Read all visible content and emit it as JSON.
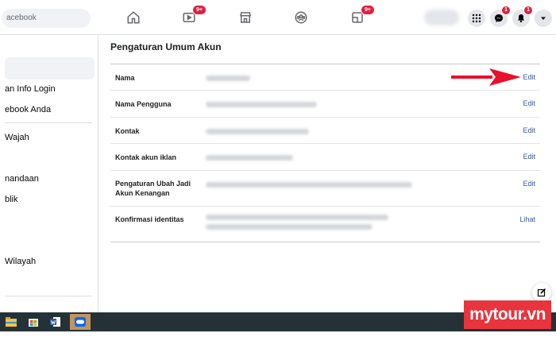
{
  "topbar": {
    "search_placeholder": "acebook",
    "nav": [
      {
        "icon": "home-icon",
        "badge": ""
      },
      {
        "icon": "watch-icon",
        "badge": "9+"
      },
      {
        "icon": "marketplace-icon",
        "badge": ""
      },
      {
        "icon": "groups-icon",
        "badge": ""
      },
      {
        "icon": "gaming-icon",
        "badge": "9+"
      }
    ],
    "messenger_badge": "1",
    "notifications_badge": "1"
  },
  "sidebar": {
    "items": [
      {
        "label": "an Info Login"
      },
      {
        "label": "ebook Anda"
      },
      {
        "label": "Wajah"
      },
      {
        "label": "nandaan"
      },
      {
        "label": "blik"
      },
      {
        "label": "Wilayah"
      }
    ]
  },
  "main": {
    "title": "Pengaturan Umum Akun",
    "rows": [
      {
        "label": "Nama",
        "action": "Edit"
      },
      {
        "label": "Nama Pengguna",
        "action": "Edit"
      },
      {
        "label": "Kontak",
        "action": "Edit"
      },
      {
        "label": "Kontak akun iklan",
        "action": "Edit"
      },
      {
        "label": "Pengaturan Ubah Jadi Akun Kenangan",
        "action": "Edit"
      },
      {
        "label": "Konfirmasi identitas",
        "action": "Lihat"
      }
    ]
  },
  "watermark": "mytour.vn",
  "colors": {
    "accent": "#385898",
    "badge": "#e41e3f",
    "arrow": "#e8102a",
    "taskbar": "#243238",
    "watermark": "#e8343d"
  }
}
